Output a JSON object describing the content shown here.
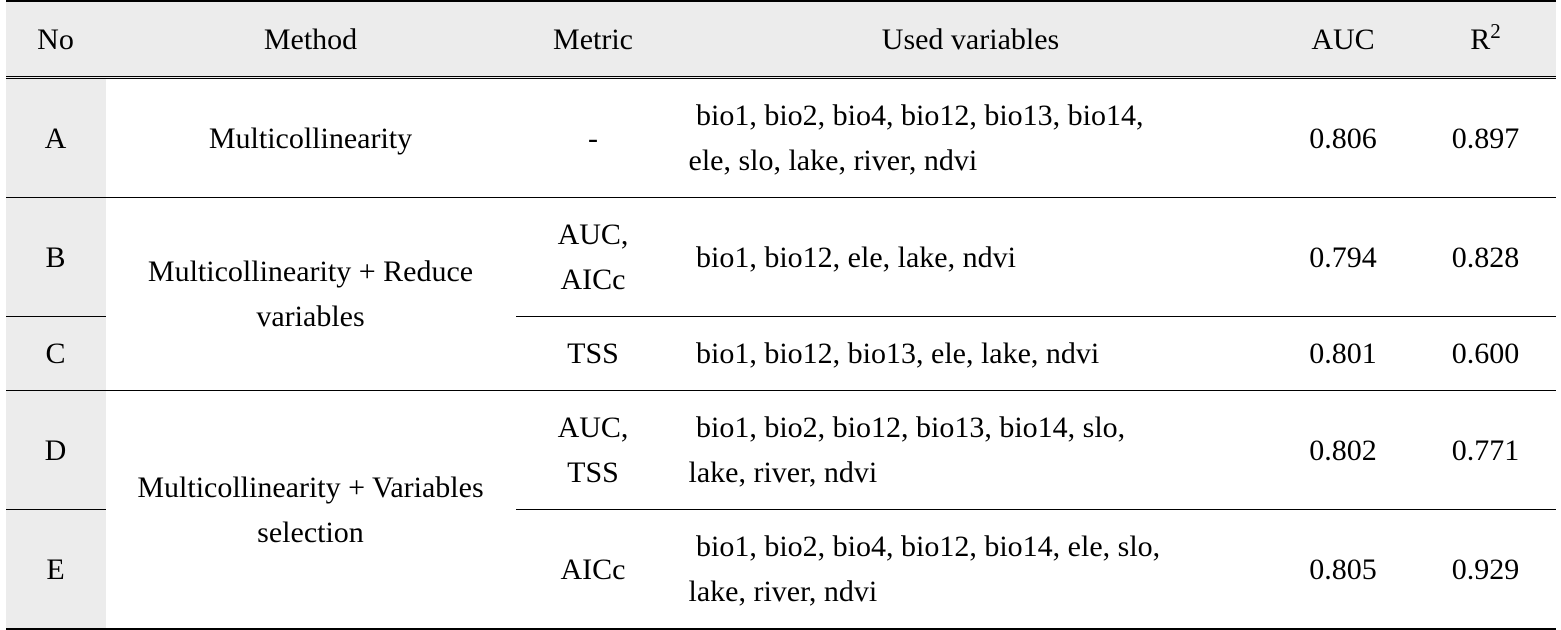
{
  "headers": {
    "no": "No",
    "method": "Method",
    "metric": "Metric",
    "vars": "Used variables",
    "auc": "AUC",
    "r2_pre": "R",
    "r2_sup": "2"
  },
  "rows": {
    "A": {
      "no": "A",
      "method": "Multicollinearity",
      "metric": "-",
      "vars1": " bio1, bio2, bio4, bio12, bio13, bio14,",
      "vars2": "ele, slo, lake, river, ndvi",
      "auc": "0.806",
      "r2": "0.897"
    },
    "B": {
      "no": "B",
      "metric1": "AUC,",
      "metric2": "AICc",
      "vars": " bio1, bio12, ele, lake, ndvi",
      "auc": "0.794",
      "r2": "0.828"
    },
    "BC_method1": "Multicollinearity + Reduce",
    "BC_method2": "variables",
    "C": {
      "no": "C",
      "metric": "TSS",
      "vars": " bio1, bio12, bio13, ele, lake, ndvi",
      "auc": "0.801",
      "r2": "0.600"
    },
    "D": {
      "no": "D",
      "metric1": "AUC,",
      "metric2": "TSS",
      "vars1": " bio1, bio2, bio12, bio13, bio14, slo,",
      "vars2": "lake, river, ndvi",
      "auc": "0.802",
      "r2": "0.771"
    },
    "DE_method1": "Multicollinearity + Variables",
    "DE_method2": "selection",
    "E": {
      "no": "E",
      "metric": "AICc",
      "vars1": " bio1, bio2, bio4, bio12, bio14, ele, slo,",
      "vars2": "lake, river, ndvi",
      "auc": "0.805",
      "r2": "0.929"
    }
  },
  "chart_data": {
    "type": "table",
    "columns": [
      "No",
      "Method",
      "Metric",
      "Used variables",
      "AUC",
      "R2"
    ],
    "rows": [
      [
        "A",
        "Multicollinearity",
        "-",
        "bio1, bio2, bio4, bio12, bio13, bio14, ele, slo, lake, river, ndvi",
        0.806,
        0.897
      ],
      [
        "B",
        "Multicollinearity + Reduce variables",
        "AUC, AICc",
        "bio1, bio12, ele, lake, ndvi",
        0.794,
        0.828
      ],
      [
        "C",
        "Multicollinearity + Reduce variables",
        "TSS",
        "bio1, bio12, bio13, ele, lake, ndvi",
        0.801,
        0.6
      ],
      [
        "D",
        "Multicollinearity + Variables selection",
        "AUC, TSS",
        "bio1, bio2, bio12, bio13, bio14, slo, lake, river, ndvi",
        0.802,
        0.771
      ],
      [
        "E",
        "Multicollinearity + Variables selection",
        "AICc",
        "bio1, bio2, bio4, bio12, bio14, ele, slo, lake, river, ndvi",
        0.805,
        0.929
      ]
    ]
  }
}
